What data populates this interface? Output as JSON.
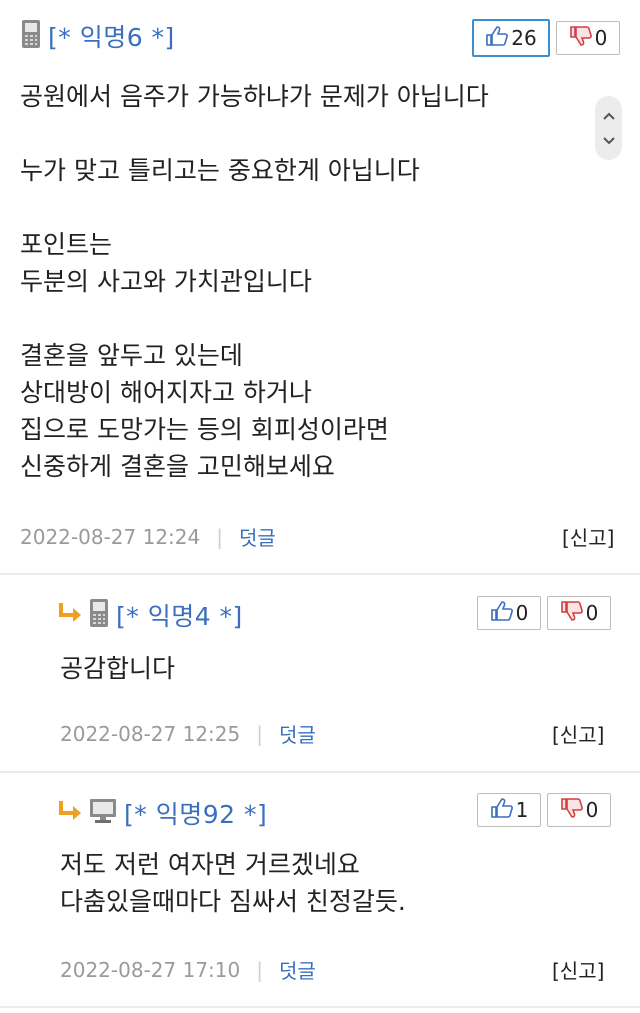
{
  "comments": [
    {
      "author": "[* 익명6 *]",
      "device": "mobile",
      "likes": "26",
      "dislikes": "0",
      "body": "공원에서 음주가 가능하냐가 문제가 아닙니다\n\n누가 맞고 틀리고는 중요한게 아닙니다\n\n포인트는\n두분의 사고와 가치관입니다\n\n결혼을 앞두고 있는데\n상대방이 해어지자고 하거나\n집으로 도망가는 등의 회피성이라면\n신중하게 결혼을 고민해보세요",
      "timestamp": "2022-08-27 12:24",
      "separator": "|",
      "reply_label": "덧글",
      "report_label": "[신고]"
    },
    {
      "author": "[* 익명4 *]",
      "device": "mobile",
      "likes": "0",
      "dislikes": "0",
      "body": "공감합니다",
      "timestamp": "2022-08-27 12:25",
      "separator": "|",
      "reply_label": "덧글",
      "report_label": "[신고]"
    },
    {
      "author": "[* 익명92 *]",
      "device": "desktop",
      "likes": "1",
      "dislikes": "0",
      "body": "저도 저런 여자면 거르겠네요\n다춤있을때마다 짐싸서 친정갈듯.",
      "timestamp": "2022-08-27 17:10",
      "separator": "|",
      "reply_label": "덧글",
      "report_label": "[신고]"
    }
  ],
  "colors": {
    "author": "#3a6fbf",
    "like_highlight": "#3a8fd0",
    "reply_arrow": "#f0a020",
    "dislike_icon": "#d04040"
  }
}
